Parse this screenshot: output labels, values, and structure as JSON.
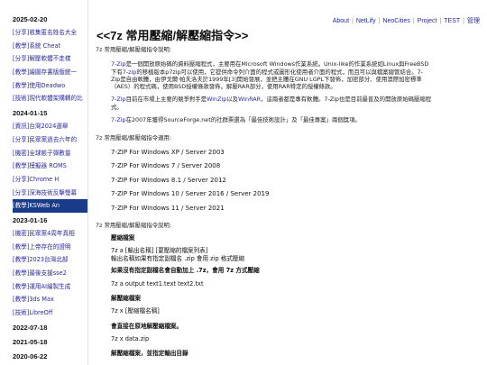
{
  "sidebar": {
    "groups": [
      {
        "date": "2025-02-20",
        "items": [
          {
            "tag": "[分享]",
            "text": "收集匿名姓名大全"
          },
          {
            "tag": "[教學]",
            "text": "系統 Cheat"
          },
          {
            "tag": "[分享]",
            "text": "解壓軟體不走樣"
          },
          {
            "tag": "[教學]",
            "text": "繪圖存書版版統一"
          },
          {
            "tag": "[教學]",
            "text": "使用Deadwo"
          },
          {
            "tag": "[技術]",
            "text": "現代軟體架構轉的比"
          }
        ]
      },
      {
        "date": "2024-01-15",
        "items": [
          {
            "tag": "[資訊]",
            "text": "台灣2024選舉"
          },
          {
            "tag": "[分享]",
            "text": "民眾黨過去六年的"
          },
          {
            "tag": "[機密]",
            "text": "全球帳子彈數量"
          },
          {
            "tag": "[教學]",
            "text": "模擬器 ROMS"
          },
          {
            "tag": "[分享]",
            "text": "Chrome H"
          },
          {
            "tag": "[分享]",
            "text": "深海技術反擊螢幕"
          },
          {
            "tag": "[教學]",
            "text": "KSWeb An",
            "highlight": true
          }
        ]
      },
      {
        "date": "2023-01-16",
        "items": [
          {
            "tag": "[機密]",
            "text": "民眾黨4周年真相"
          },
          {
            "tag": "[教學]",
            "text": "上帝存在的證明"
          },
          {
            "tag": "[教學]",
            "text": "2023台灣北部"
          },
          {
            "tag": "[教學]",
            "text": "最後支援sse2"
          },
          {
            "tag": "[教學]",
            "text": "運用AI繪製生成"
          },
          {
            "tag": "[教學]",
            "text": "3ds Max"
          },
          {
            "tag": "[技術]",
            "text": "LibreOff"
          }
        ]
      },
      {
        "date": "2022-07-18",
        "items": []
      },
      {
        "date": "2021-05-18",
        "items": []
      },
      {
        "date": "2020-06-22",
        "items": []
      }
    ]
  },
  "topnav": {
    "links": [
      "About",
      "NetLify",
      "NeoCities",
      "Project",
      "TEST",
      "管理"
    ]
  },
  "main": {
    "title": "<<7z 常用壓縮/解壓縮指令>>",
    "intro_label": "7z 常用壓縮/解壓縮指令說明:",
    "para1": {
      "l1_pre": "7-Zip",
      "l1_text": "是一個開放原始碼的資料壓縮程式，主要用在Microsoft Windows作業系統。Unix-like的作業系統如Linux與FreeBSD",
      "l2_pre": "下有",
      "l2_link": "7-zip",
      "l2_text": "的移植版本p7zip可以使用，它提供命令列介面的程式或圖形化使用者介面的程式，而且可以與檔案總管結合。7-",
      "l3": "Zip是自由軟體，由伊戈爾·帕夫洛夫於1999年[3]開始發展，並把主體在GNU LGPL下發佈，加密部分、使用澳際加密標準",
      "l4": "（AES）的程式碼，使用BSD授權條款發佈。解壓RAR部分，使用RAR特定的授權條款。"
    },
    "para2": {
      "link1": "7-Zip",
      "text1": "目前在市場上主要的競爭對手是",
      "link2": "WinZip",
      "text2": "以及",
      "link3": "WinRAR",
      "text3": "，這兩者都是專有軟體。7-Zip也是目前最普及的開放原始碼壓縮程",
      "l2": "式。"
    },
    "para3": {
      "link": "7-Zip",
      "text": "在2007年獲得SourceForge.net的社群票選為「最佳技術設計」及「最佳專案」兩個獎項。"
    },
    "versions_label": "7z 常用壓縮/解壓縮指令適用:",
    "versions": [
      "7-ZIP For Windows XP / Server 2003",
      "7-ZIP For Windows 7 / Server 2008",
      "7-ZIP For Windows 8.1 / Server 2012",
      "7-ZIP For Windows 10 / Server 2016 / Server 2019",
      "7-ZIP For Windows 11 / Server 2021"
    ],
    "usage_label": "7z 常用壓縮/解壓縮指令說明:",
    "usage": {
      "h1": "壓縮檔案",
      "c1": "7z a [輸出名稱] [要壓縮的檔案列表]",
      "c1b": "輸出名稱如果有指定副檔名 .zip 會用 zip 格式壓縮",
      "h2a": "如果沒有指定副檔名會自動加上",
      "h2b": ".7z",
      "h2c": "，會用",
      "h2d": "7z",
      "h2e": "方式壓縮",
      "c2": "7z a output text1.text text2.txt",
      "h3": "解壓縮檔案",
      "c3": "7z x [壓縮檔名稱]",
      "h4": "會直接在原地解壓縮檔案。",
      "c4": "7z x data.zip",
      "h5": "解壓縮檔案，並指定輸出目錄"
    }
  }
}
